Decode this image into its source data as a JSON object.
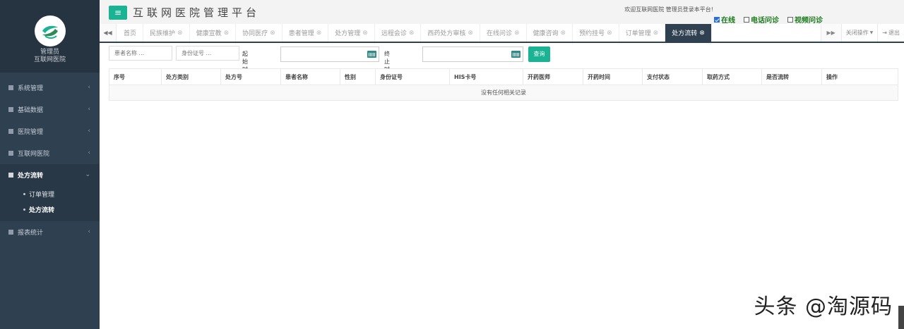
{
  "sidebar": {
    "profile": {
      "name": "管理员",
      "org": "互联网医院"
    },
    "items": [
      {
        "label": "系统管理",
        "chevron": "‹"
      },
      {
        "label": "基础数据",
        "chevron": "‹"
      },
      {
        "label": "医院管理",
        "chevron": "‹"
      },
      {
        "label": "互联网医院",
        "chevron": "‹"
      },
      {
        "label": "处方流转",
        "chevron": "⌄",
        "active": true,
        "children": [
          {
            "label": "订单管理"
          },
          {
            "label": "处方流转",
            "current": true
          }
        ]
      },
      {
        "label": "报表统计",
        "chevron": "‹"
      }
    ]
  },
  "header": {
    "menu_icon": "≡",
    "title": "互联网医院管理平台",
    "welcome": "欢迎互联网医院 管理员登录本平台!",
    "options": [
      {
        "label": "在线",
        "checked": true
      },
      {
        "label": "电话问诊",
        "checked": false
      },
      {
        "label": "视频问诊",
        "checked": false
      }
    ]
  },
  "tabs": {
    "scroll_left": "◀◀",
    "items": [
      {
        "label": "首页",
        "closable": false
      },
      {
        "label": "民族维护",
        "closable": true
      },
      {
        "label": "健康宣教",
        "closable": true
      },
      {
        "label": "协同医疗",
        "closable": true
      },
      {
        "label": "患者管理",
        "closable": true
      },
      {
        "label": "处方管理",
        "closable": true
      },
      {
        "label": "远程会诊",
        "closable": true
      },
      {
        "label": "西药处方审核",
        "closable": true
      },
      {
        "label": "在线问诊",
        "closable": true
      },
      {
        "label": "健康咨询",
        "closable": true
      },
      {
        "label": "预约挂号",
        "closable": true
      },
      {
        "label": "订单管理",
        "closable": true
      },
      {
        "label": "处方流转",
        "closable": true,
        "active": true
      }
    ],
    "scroll_right": "▶▶",
    "close_ops": "关闭操作",
    "logout": "退出"
  },
  "search": {
    "patient_name_placeholder": "患者名称 ...",
    "id_card_placeholder": "身份证号 ...",
    "start_label": "起始时间",
    "end_label": "终止时间",
    "query": "查询"
  },
  "table": {
    "columns": [
      "序号",
      "处方类别",
      "处方号",
      "患者名称",
      "性别",
      "身份证号",
      "HIS卡号",
      "开药医师",
      "开药时间",
      "支付状态",
      "取药方式",
      "是否流转",
      "操作"
    ],
    "empty_text": "没有任何相关记录"
  },
  "watermark": "头条 @淘源码",
  "colors": {
    "sidebar": "#2f4050",
    "accent": "#1ab394",
    "option_text": "#1a7a1a"
  }
}
